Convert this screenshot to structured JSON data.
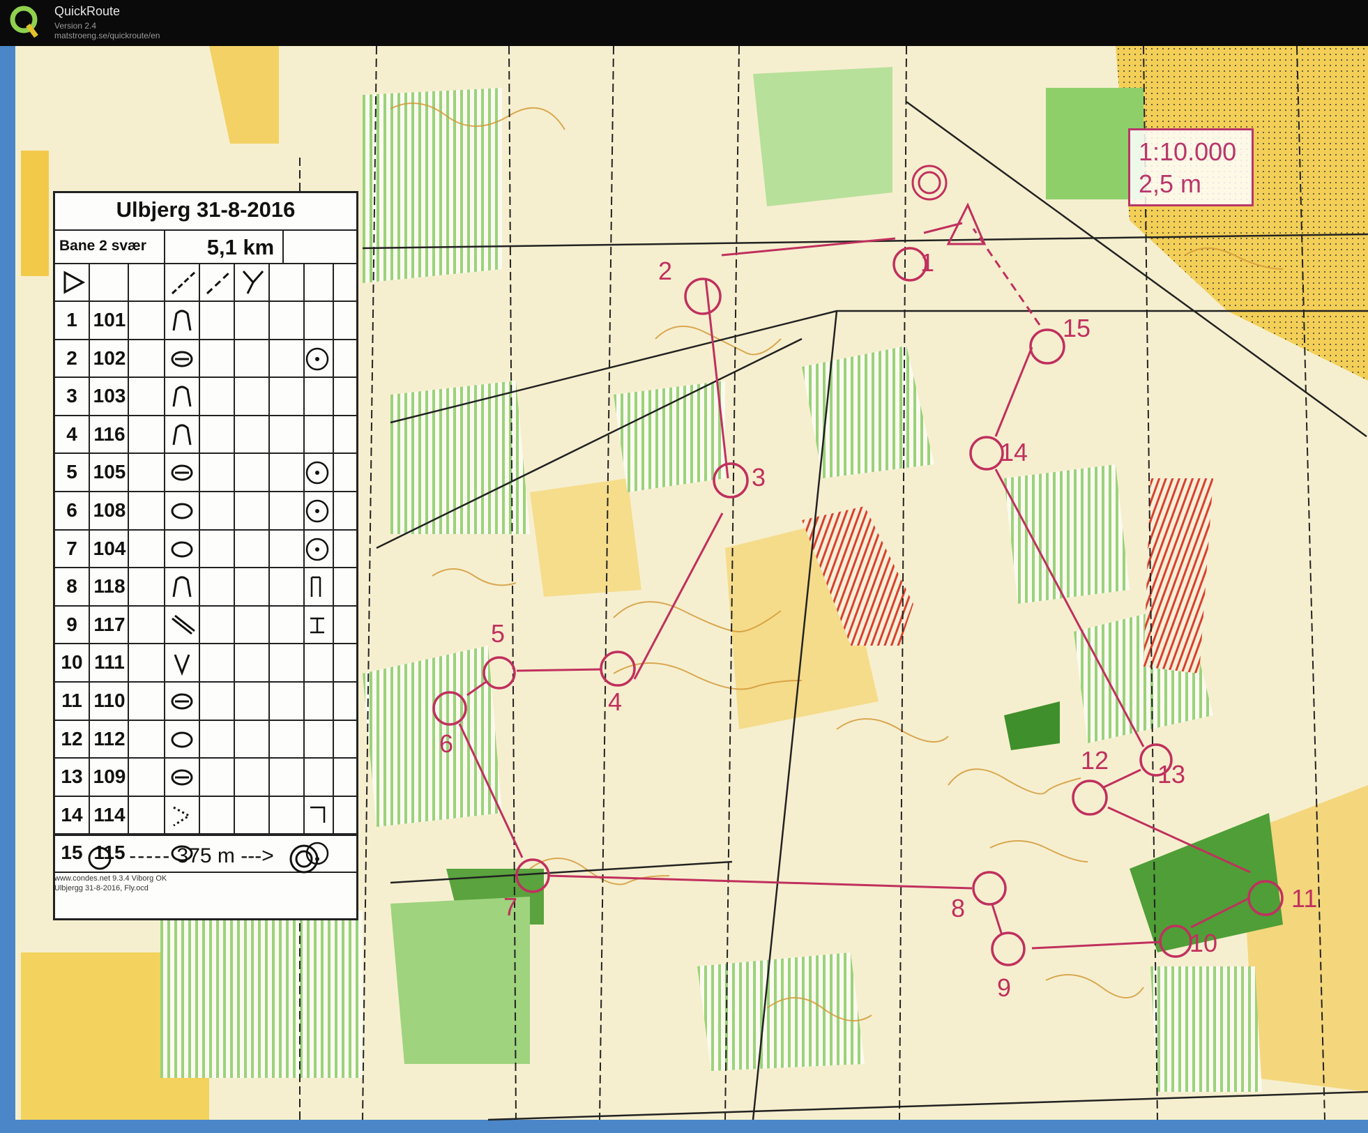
{
  "app": {
    "name": "QuickRoute",
    "version": "Version 2.4",
    "url": "matstroeng.se/quickroute/en"
  },
  "map": {
    "scale": "1:10.000",
    "contour_interval": "2,5 m"
  },
  "description_sheet": {
    "event": "Ulbjerg 31-8-2016",
    "course": "Bane 2 svær",
    "length": "5,1 km",
    "controls": [
      {
        "n": "1",
        "code": "101"
      },
      {
        "n": "2",
        "code": "102"
      },
      {
        "n": "3",
        "code": "103"
      },
      {
        "n": "4",
        "code": "116"
      },
      {
        "n": "5",
        "code": "105"
      },
      {
        "n": "6",
        "code": "108"
      },
      {
        "n": "7",
        "code": "104"
      },
      {
        "n": "8",
        "code": "118"
      },
      {
        "n": "9",
        "code": "117"
      },
      {
        "n": "10",
        "code": "111"
      },
      {
        "n": "11",
        "code": "110"
      },
      {
        "n": "12",
        "code": "112"
      },
      {
        "n": "13",
        "code": "109"
      },
      {
        "n": "14",
        "code": "114"
      },
      {
        "n": "15",
        "code": "115"
      }
    ],
    "finish_distance": "375 m",
    "credit1": "www.condes.net 9.3.4 Viborg OK",
    "credit2": "Ulbjergg 31-8-2016, Fly.ocd"
  },
  "control_labels": [
    "1",
    "2",
    "3",
    "4",
    "5",
    "6",
    "7",
    "8",
    "9",
    "10",
    "11",
    "12",
    "13",
    "14",
    "15"
  ],
  "colors": {
    "course": "#c0305e",
    "forest_green": "#8cc86a",
    "open_yellow": "#f5d77a",
    "contour_brown": "#d49a3a"
  }
}
